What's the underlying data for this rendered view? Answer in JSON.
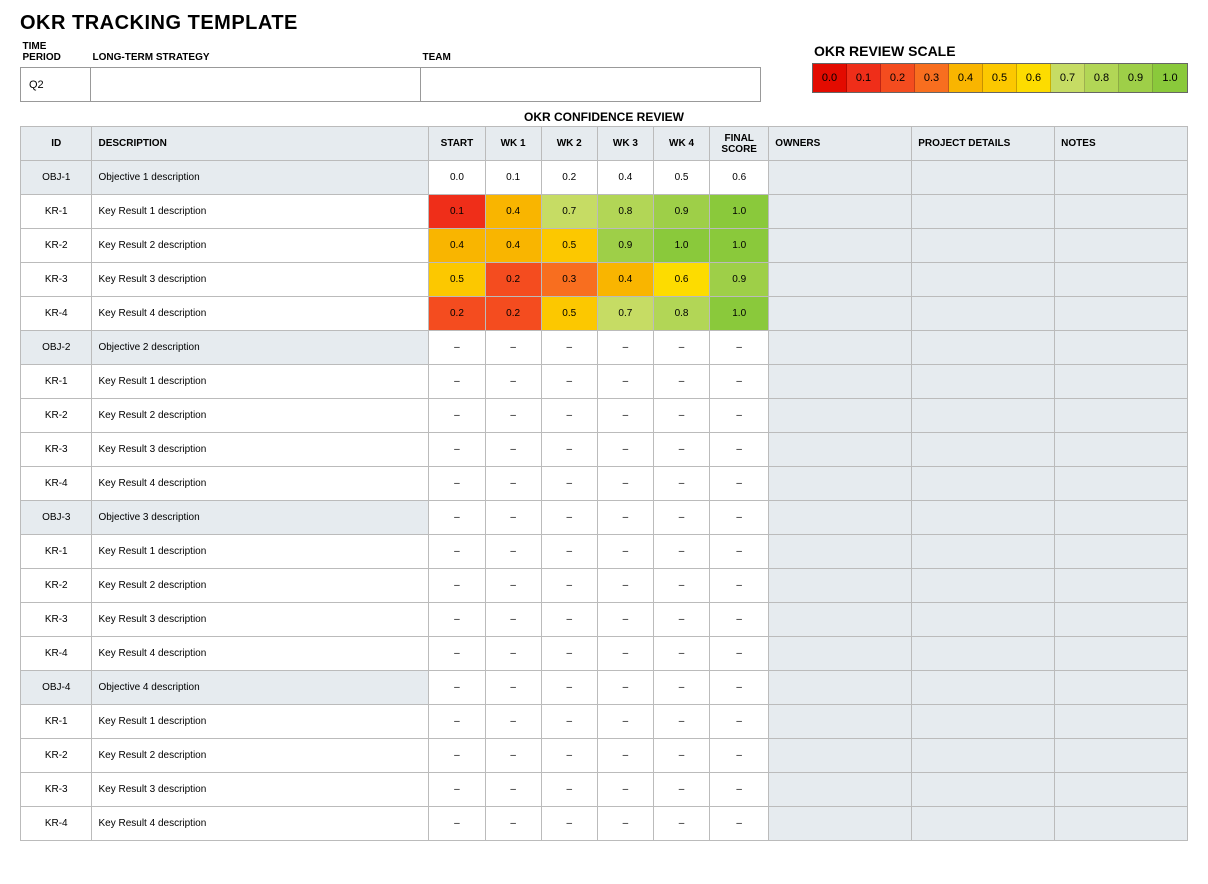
{
  "title": "OKR TRACKING TEMPLATE",
  "meta": {
    "time_period_label": "TIME PERIOD",
    "strategy_label": "LONG-TERM STRATEGY",
    "team_label": "TEAM",
    "time_period_value": "Q2",
    "strategy_value": "",
    "team_value": ""
  },
  "scale": {
    "title": "OKR REVIEW SCALE",
    "values": [
      "0.0",
      "0.1",
      "0.2",
      "0.3",
      "0.4",
      "0.5",
      "0.6",
      "0.7",
      "0.8",
      "0.9",
      "1.0"
    ]
  },
  "okr_caption": "OKR CONFIDENCE REVIEW",
  "columns": {
    "id": "ID",
    "description": "DESCRIPTION",
    "start": "START",
    "wk1": "WK 1",
    "wk2": "WK 2",
    "wk3": "WK 3",
    "wk4": "WK 4",
    "final": "FINAL SCORE",
    "owners": "OWNERS",
    "project": "PROJECT DETAILS",
    "notes": "NOTES"
  },
  "rows": [
    {
      "type": "obj",
      "id": "OBJ-1",
      "desc": "Objective 1 description",
      "scores": [
        "0.0",
        "0.1",
        "0.2",
        "0.4",
        "0.5",
        "0.6"
      ]
    },
    {
      "type": "kr",
      "id": "KR-1",
      "desc": "Key Result 1 description",
      "scores": [
        "0.1",
        "0.4",
        "0.7",
        "0.8",
        "0.9",
        "1.0"
      ]
    },
    {
      "type": "kr",
      "id": "KR-2",
      "desc": "Key Result 2 description",
      "scores": [
        "0.4",
        "0.4",
        "0.5",
        "0.9",
        "1.0",
        "1.0"
      ]
    },
    {
      "type": "kr",
      "id": "KR-3",
      "desc": "Key Result 3 description",
      "scores": [
        "0.5",
        "0.2",
        "0.3",
        "0.4",
        "0.6",
        "0.9"
      ]
    },
    {
      "type": "kr",
      "id": "KR-4",
      "desc": "Key Result 4 description",
      "scores": [
        "0.2",
        "0.2",
        "0.5",
        "0.7",
        "0.8",
        "1.0"
      ]
    },
    {
      "type": "obj",
      "id": "OBJ-2",
      "desc": "Objective 2 description",
      "scores": [
        "–",
        "–",
        "–",
        "–",
        "–",
        "–"
      ]
    },
    {
      "type": "kr",
      "id": "KR-1",
      "desc": "Key Result 1 description",
      "scores": [
        "–",
        "–",
        "–",
        "–",
        "–",
        "–"
      ]
    },
    {
      "type": "kr",
      "id": "KR-2",
      "desc": "Key Result 2 description",
      "scores": [
        "–",
        "–",
        "–",
        "–",
        "–",
        "–"
      ]
    },
    {
      "type": "kr",
      "id": "KR-3",
      "desc": "Key Result 3 description",
      "scores": [
        "–",
        "–",
        "–",
        "–",
        "–",
        "–"
      ]
    },
    {
      "type": "kr",
      "id": "KR-4",
      "desc": "Key Result 4 description",
      "scores": [
        "–",
        "–",
        "–",
        "–",
        "–",
        "–"
      ]
    },
    {
      "type": "obj",
      "id": "OBJ-3",
      "desc": "Objective 3 description",
      "scores": [
        "–",
        "–",
        "–",
        "–",
        "–",
        "–"
      ]
    },
    {
      "type": "kr",
      "id": "KR-1",
      "desc": "Key Result 1 description",
      "scores": [
        "–",
        "–",
        "–",
        "–",
        "–",
        "–"
      ]
    },
    {
      "type": "kr",
      "id": "KR-2",
      "desc": "Key Result 2 description",
      "scores": [
        "–",
        "–",
        "–",
        "–",
        "–",
        "–"
      ]
    },
    {
      "type": "kr",
      "id": "KR-3",
      "desc": "Key Result 3 description",
      "scores": [
        "–",
        "–",
        "–",
        "–",
        "–",
        "–"
      ]
    },
    {
      "type": "kr",
      "id": "KR-4",
      "desc": "Key Result 4 description",
      "scores": [
        "–",
        "–",
        "–",
        "–",
        "–",
        "–"
      ]
    },
    {
      "type": "obj",
      "id": "OBJ-4",
      "desc": "Objective 4 description",
      "scores": [
        "–",
        "–",
        "–",
        "–",
        "–",
        "–"
      ]
    },
    {
      "type": "kr",
      "id": "KR-1",
      "desc": "Key Result 1 description",
      "scores": [
        "–",
        "–",
        "–",
        "–",
        "–",
        "–"
      ]
    },
    {
      "type": "kr",
      "id": "KR-2",
      "desc": "Key Result 2 description",
      "scores": [
        "–",
        "–",
        "–",
        "–",
        "–",
        "–"
      ]
    },
    {
      "type": "kr",
      "id": "KR-3",
      "desc": "Key Result 3 description",
      "scores": [
        "–",
        "–",
        "–",
        "–",
        "–",
        "–"
      ]
    },
    {
      "type": "kr",
      "id": "KR-4",
      "desc": "Key Result 4 description",
      "scores": [
        "–",
        "–",
        "–",
        "–",
        "–",
        "–"
      ]
    }
  ]
}
